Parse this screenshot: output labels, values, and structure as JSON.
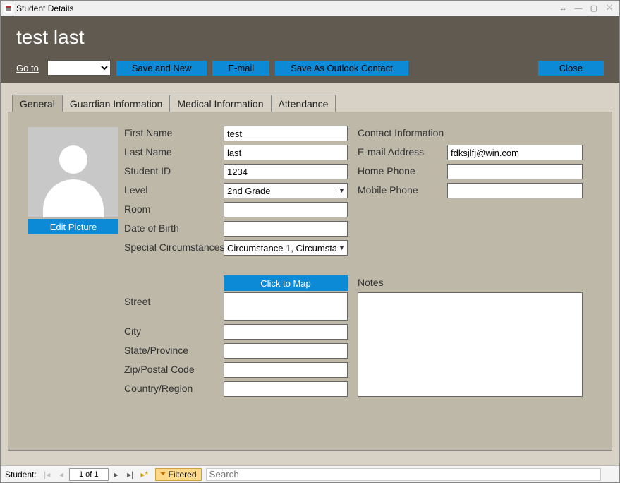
{
  "window": {
    "title": "Student Details"
  },
  "header": {
    "name": "test last"
  },
  "toolbar": {
    "goto_label": "Go to",
    "goto_value": "",
    "save_label": "Save and New",
    "email_label": "E-mail",
    "outlook_label": "Save As Outlook Contact",
    "close_label": "Close"
  },
  "tabs": {
    "general": "General",
    "guardian": "Guardian Information",
    "medical": "Medical Information",
    "attendance": "Attendance"
  },
  "picture": {
    "edit_label": "Edit Picture"
  },
  "labels": {
    "first_name": "First Name",
    "last_name": "Last Name",
    "student_id": "Student ID",
    "level": "Level",
    "room": "Room",
    "dob": "Date of Birth",
    "special": "Special Circumstances",
    "street": "Street",
    "city": "City",
    "state": "State/Province",
    "zip": "Zip/Postal Code",
    "country": "Country/Region",
    "map_btn": "Click to Map",
    "contact_header": "Contact Information",
    "email": "E-mail Address",
    "home_phone": "Home Phone",
    "mobile_phone": "Mobile Phone",
    "notes": "Notes"
  },
  "values": {
    "first_name": "test",
    "last_name": "last",
    "student_id": "1234",
    "level": "2nd Grade",
    "room": "",
    "dob": "",
    "special": "Circumstance 1, Circumstan",
    "street": "",
    "city": "",
    "state": "",
    "zip": "",
    "country": "",
    "email": "fdksjlfj@win.com",
    "home_phone": "",
    "mobile_phone": "",
    "notes": ""
  },
  "recnav": {
    "label": "Student:",
    "position": "1 of 1",
    "filter": "Filtered",
    "search_placeholder": "Search"
  }
}
